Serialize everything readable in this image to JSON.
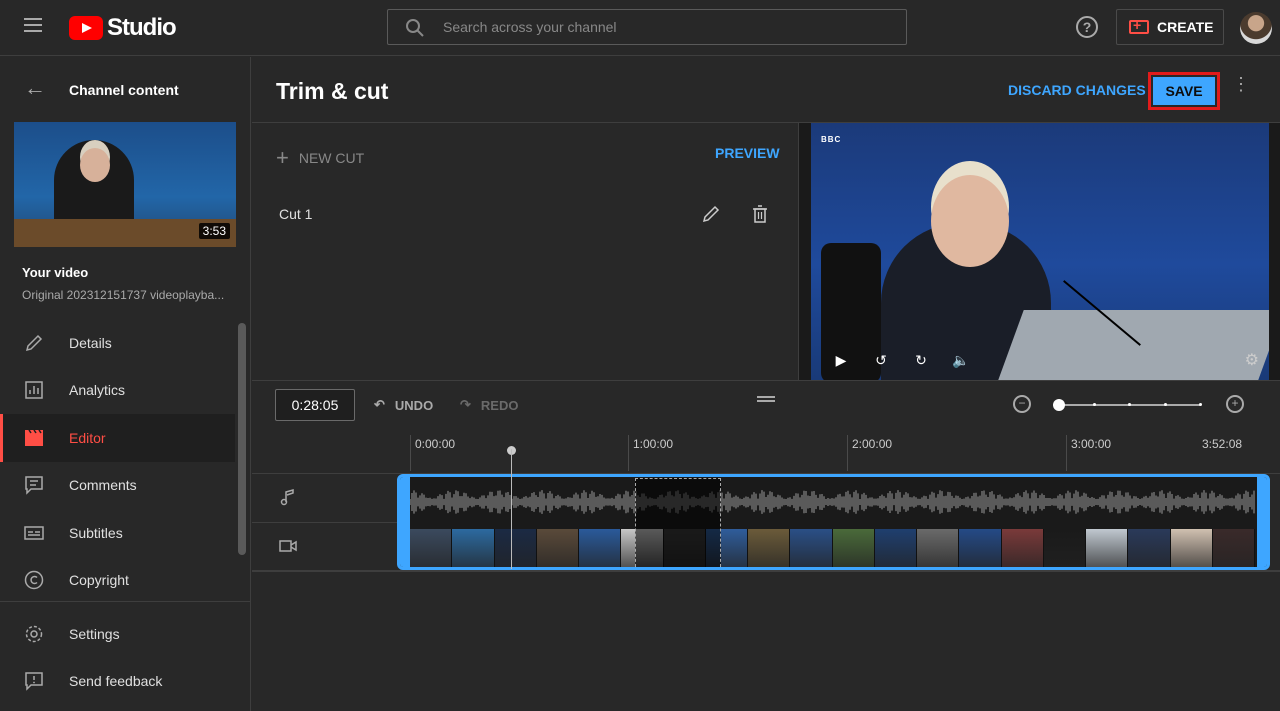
{
  "app": {
    "name": "Studio"
  },
  "search": {
    "placeholder": "Search across your channel"
  },
  "header": {
    "create_label": "CREATE",
    "help": "?"
  },
  "sidebar": {
    "back_title": "Channel content",
    "thumbnail_duration": "3:53",
    "your_video": "Your video",
    "original_name": "Original 202312151737 videoplayba...",
    "items": [
      {
        "label": "Details",
        "icon": "pencil-icon"
      },
      {
        "label": "Analytics",
        "icon": "analytics-icon"
      },
      {
        "label": "Editor",
        "icon": "editor-clapper-icon",
        "active": true
      },
      {
        "label": "Comments",
        "icon": "comments-icon"
      },
      {
        "label": "Subtitles",
        "icon": "subtitles-icon"
      },
      {
        "label": "Copyright",
        "icon": "copyright-icon"
      }
    ],
    "footer_items": [
      {
        "label": "Settings",
        "icon": "gear-icon"
      },
      {
        "label": "Send feedback",
        "icon": "feedback-icon"
      }
    ]
  },
  "editor": {
    "title": "Trim & cut",
    "discard_label": "DISCARD CHANGES",
    "save_label": "SAVE",
    "new_cut_label": "NEW CUT",
    "preview_label": "PREVIEW",
    "cuts": [
      {
        "label": "Cut 1"
      }
    ],
    "video_overlay_badge": "BBC"
  },
  "timeline": {
    "timecode": "0:28:05",
    "undo_label": "UNDO",
    "redo_label": "REDO",
    "ticks": [
      "0:00:00",
      "1:00:00",
      "2:00:00",
      "3:00:00",
      "3:52:08"
    ]
  },
  "colors": {
    "accent_blue": "#3ea6ff",
    "active_red": "#ff4e45",
    "highlight_red": "#e21b1b",
    "background": "#282828"
  }
}
